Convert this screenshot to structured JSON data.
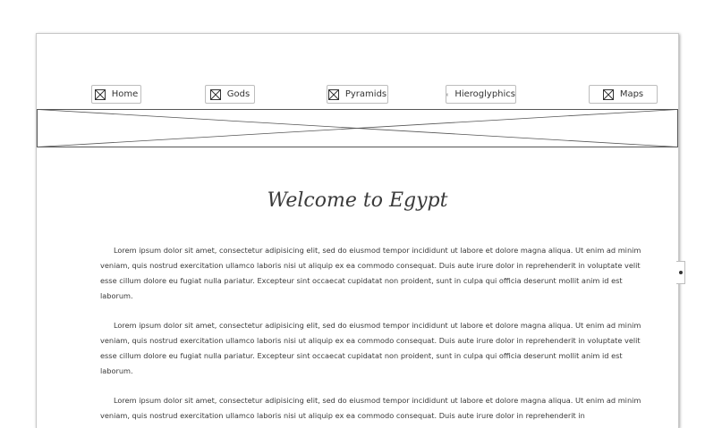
{
  "nav": [
    {
      "label": "Home"
    },
    {
      "label": "Gods"
    },
    {
      "label": "Pyramids"
    },
    {
      "label": "Hieroglyphics"
    },
    {
      "label": "Maps"
    }
  ],
  "main": {
    "title": "Welcome to Egypt",
    "paragraphs": [
      "Lorem ipsum dolor sit amet, consectetur adipisicing elit, sed do eiusmod tempor incididunt ut labore et dolore magna aliqua. Ut enim ad minim veniam, quis nostrud exercitation ullamco laboris nisi ut aliquip ex ea commodo consequat. Duis aute irure dolor in reprehenderit in voluptate velit esse cillum dolore eu fugiat nulla pariatur. Excepteur sint occaecat cupidatat non proident, sunt in culpa qui officia deserunt mollit anim id est laborum.",
      "Lorem ipsum dolor sit amet, consectetur adipisicing elit, sed do eiusmod tempor incididunt ut labore et dolore magna aliqua. Ut enim ad minim veniam, quis nostrud exercitation ullamco laboris nisi ut aliquip ex ea commodo consequat. Duis aute irure dolor in reprehenderit in voluptate velit esse cillum dolore eu fugiat nulla pariatur. Excepteur sint occaecat cupidatat non proident, sunt in culpa qui officia deserunt mollit anim id est laborum.",
      "Lorem ipsum dolor sit amet, consectetur adipisicing elit, sed do eiusmod tempor incididunt ut labore et dolore magna aliqua. Ut enim ad minim veniam, quis nostrud exercitation ullamco laboris nisi ut aliquip ex ea commodo consequat. Duis aute irure dolor in reprehenderit in"
    ]
  },
  "icons": {
    "nav_icon": "image-placeholder-icon",
    "banner": "image-placeholder",
    "scroll": "scroll-handle-icon"
  }
}
